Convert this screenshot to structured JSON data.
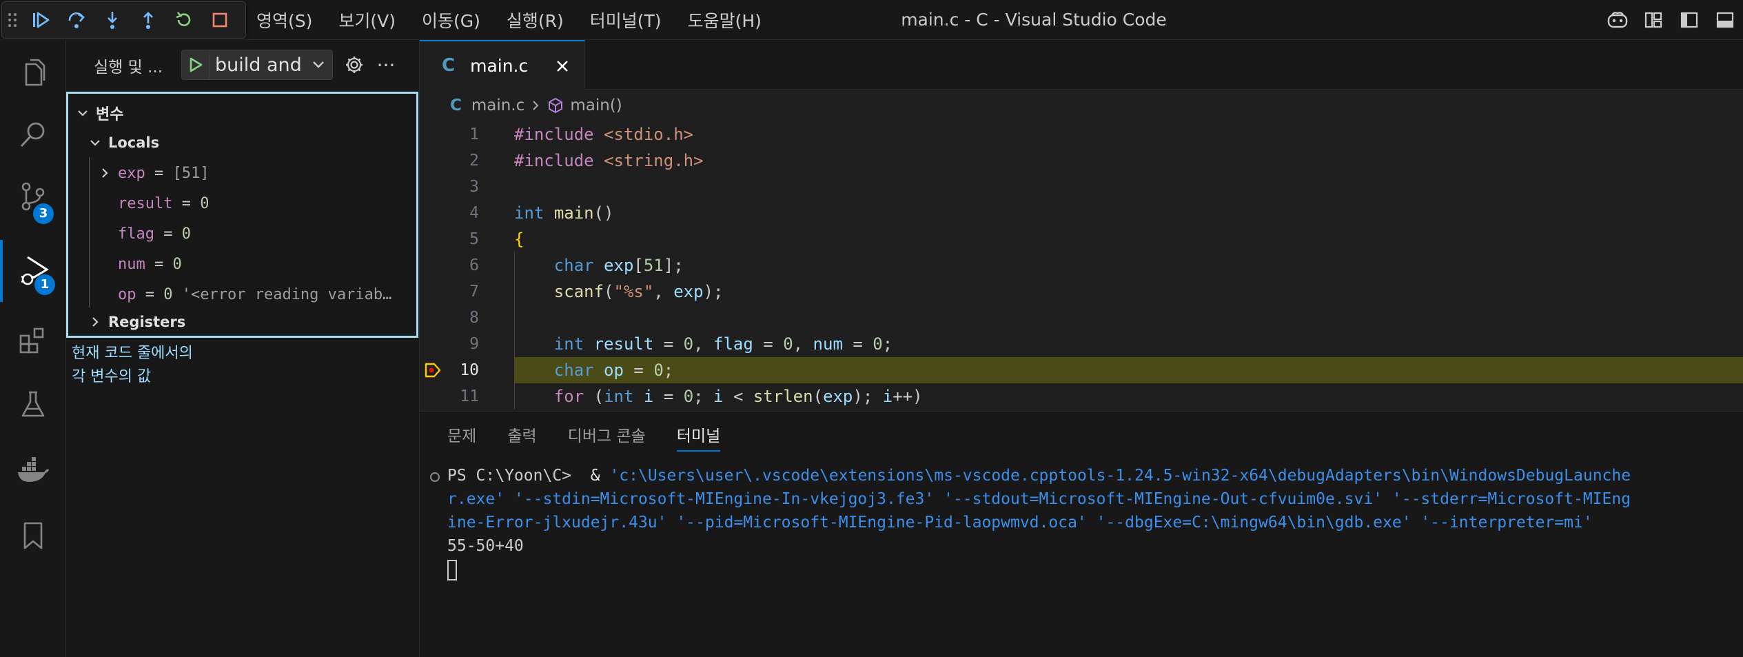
{
  "menubar": {
    "items": [
      "영역(S)",
      "보기(V)",
      "이동(G)",
      "실행(R)",
      "터미널(T)",
      "도움말(H)"
    ]
  },
  "window": {
    "title": "main.c - C - Visual Studio Code"
  },
  "activitybar": {
    "scm_badge": "3",
    "debug_badge": "1"
  },
  "sidebar": {
    "title": "실행 및 ...",
    "launch_config": "build and debug",
    "variables": {
      "section_title": "변수",
      "locals_title": "Locals",
      "registers_title": "Registers",
      "items": [
        {
          "name": "exp",
          "value": "[51]"
        },
        {
          "name": "result",
          "value": "0"
        },
        {
          "name": "flag",
          "value": "0"
        },
        {
          "name": "num",
          "value": "0"
        },
        {
          "name": "op",
          "value": "0",
          "extra": "'<error reading variab…"
        }
      ]
    },
    "annotation": [
      "현재 코드 줄에서의",
      "각 변수의 값"
    ]
  },
  "editor": {
    "tab_label": "main.c",
    "breadcrumb_file": "main.c",
    "breadcrumb_symbol": "main()",
    "line_numbers": [
      "1",
      "2",
      "3",
      "4",
      "5",
      "6",
      "7",
      "8",
      "9",
      "10",
      "11"
    ],
    "current_line": "10"
  },
  "panel": {
    "tabs": [
      "문제",
      "출력",
      "디버그 콘솔",
      "터미널"
    ],
    "terminal": {
      "prompt": "PS C:\\Yoon\\C>",
      "amp": "&",
      "cmd_line1": "'c:\\Users\\user\\.vscode\\extensions\\ms-vscode.cpptools-1.24.5-win32-x64\\debugAdapters\\bin\\WindowsDebugLaunche",
      "cmd_line2": "r.exe' '--stdin=Microsoft-MIEngine-In-vkejgoj3.fe3' '--stdout=Microsoft-MIEngine-Out-cfvuim0e.svi' '--stderr=Microsoft-MIEng",
      "cmd_line3": "ine-Error-jlxudejr.43u' '--pid=Microsoft-MIEngine-Pid-laopwmvd.oca' '--dbgExe=C:\\mingw64\\bin\\gdb.exe' '--interpreter=mi'",
      "input_echo": "55-50+40"
    }
  },
  "colors": {
    "accent": "#0078d4",
    "highlight_border": "#a8dcef",
    "current_line": "#4b4b18"
  }
}
